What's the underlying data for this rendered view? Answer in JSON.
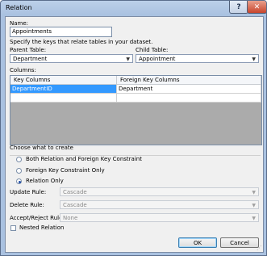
{
  "window": {
    "title": "Relation",
    "help_glyph": "?",
    "close_glyph": "✕"
  },
  "name": {
    "label": "Name:",
    "value": "Appointments"
  },
  "instructions": "Specify the keys that relate tables in your dataset.",
  "parent_table": {
    "label": "Parent Table:",
    "value": "Department"
  },
  "child_table": {
    "label": "Child Table:",
    "value": "Appointment"
  },
  "columns": {
    "label": "Columns:",
    "headers": [
      "Key Columns",
      "Foreign Key Columns"
    ],
    "rows": [
      [
        "DepartmentID",
        "Department"
      ]
    ]
  },
  "create": {
    "label": "Choose what to create",
    "options": [
      "Both Relation and Foreign Key Constraint",
      "Foreign Key Constraint Only",
      "Relation Only"
    ],
    "selected": "Relation Only"
  },
  "rules": {
    "update": {
      "label": "Update Rule:",
      "value": "Cascade"
    },
    "delete": {
      "label": "Delete Rule:",
      "value": "Cascade"
    },
    "accept_reject": {
      "label": "Accept/Reject Rule:",
      "value": "None"
    }
  },
  "nested": {
    "label": "Nested Relation",
    "checked": false
  },
  "buttons": {
    "ok": "OK",
    "cancel": "Cancel"
  },
  "icons": {
    "dropdown": "chevron-down-icon",
    "close": "close-icon",
    "help": "help-icon",
    "resize": "resize-grip-icon"
  }
}
